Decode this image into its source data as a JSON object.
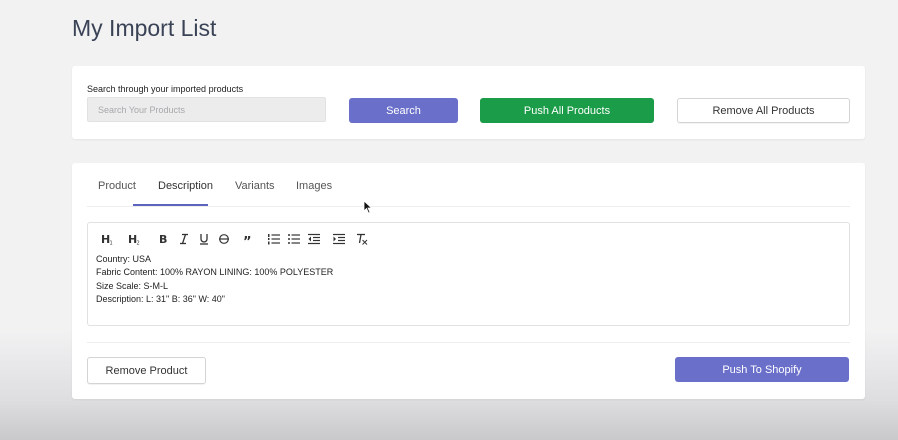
{
  "page": {
    "title": "My Import List"
  },
  "search": {
    "label": "Search through your imported products",
    "placeholder": "Search Your Products",
    "search_button": "Search",
    "push_all_button": "Push All Products",
    "remove_all_button": "Remove All Products"
  },
  "tabs": [
    {
      "label": "Product",
      "active": false
    },
    {
      "label": "Description",
      "active": true
    },
    {
      "label": "Variants",
      "active": false
    },
    {
      "label": "Images",
      "active": false
    }
  ],
  "toolbar": {
    "heading1": "H1",
    "heading2": "H2",
    "icons": [
      "bold-icon",
      "italic-icon",
      "underline-icon",
      "strikethrough-icon",
      "blockquote-icon",
      "ordered-list-icon",
      "bullet-list-icon",
      "outdent-icon",
      "indent-icon",
      "clear-format-icon"
    ]
  },
  "description": {
    "lines": [
      "Country: USA",
      "Fabric Content: 100% RAYON LINING: 100% POLYESTER",
      "Size Scale: S-M-L",
      "Description: L: 31\" B: 36\" W: 40\""
    ]
  },
  "actions": {
    "remove_product": "Remove Product",
    "push_to_shopify": "Push To Shopify"
  },
  "colors": {
    "primary": "#6a6fc9",
    "success": "#1b9c48",
    "tab_underline": "#5c64c0"
  }
}
